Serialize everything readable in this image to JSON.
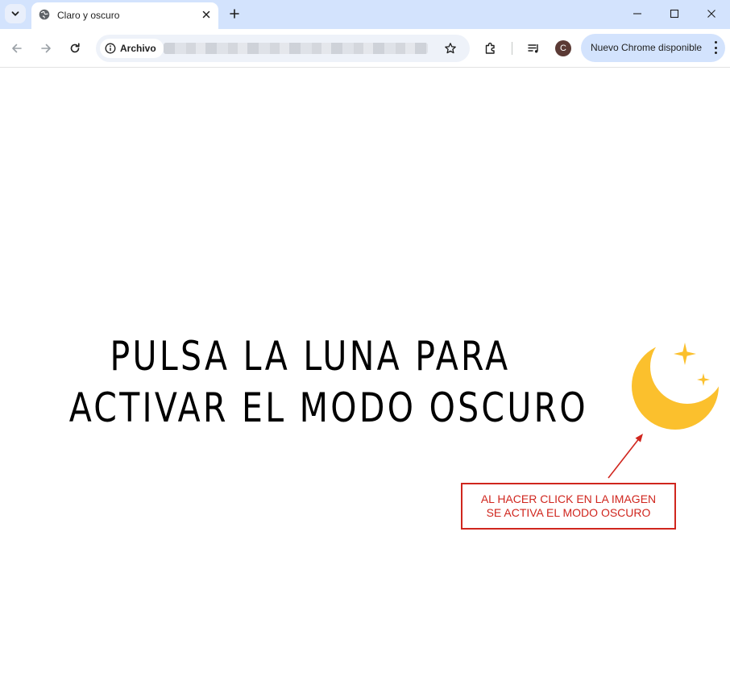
{
  "browser": {
    "tab": {
      "title": "Claro y oscuro"
    },
    "address_bar": {
      "security_chip": "Archivo"
    },
    "profile": {
      "initial": "C"
    },
    "update_button": {
      "label": "Nuevo Chrome disponible"
    }
  },
  "page": {
    "headline": {
      "line1": "PULSA LA LUNA PARA",
      "line2": "ACTIVAR EL MODO OSCURO"
    },
    "moon": {
      "icon": "crescent-moon-with-stars",
      "color": "#fbc02d"
    },
    "annotation": {
      "line1": "AL HACER CLICK EN LA IMAGEN",
      "line2": "SE ACTIVA EL MODO OSCURO",
      "color": "#d0261e"
    }
  }
}
